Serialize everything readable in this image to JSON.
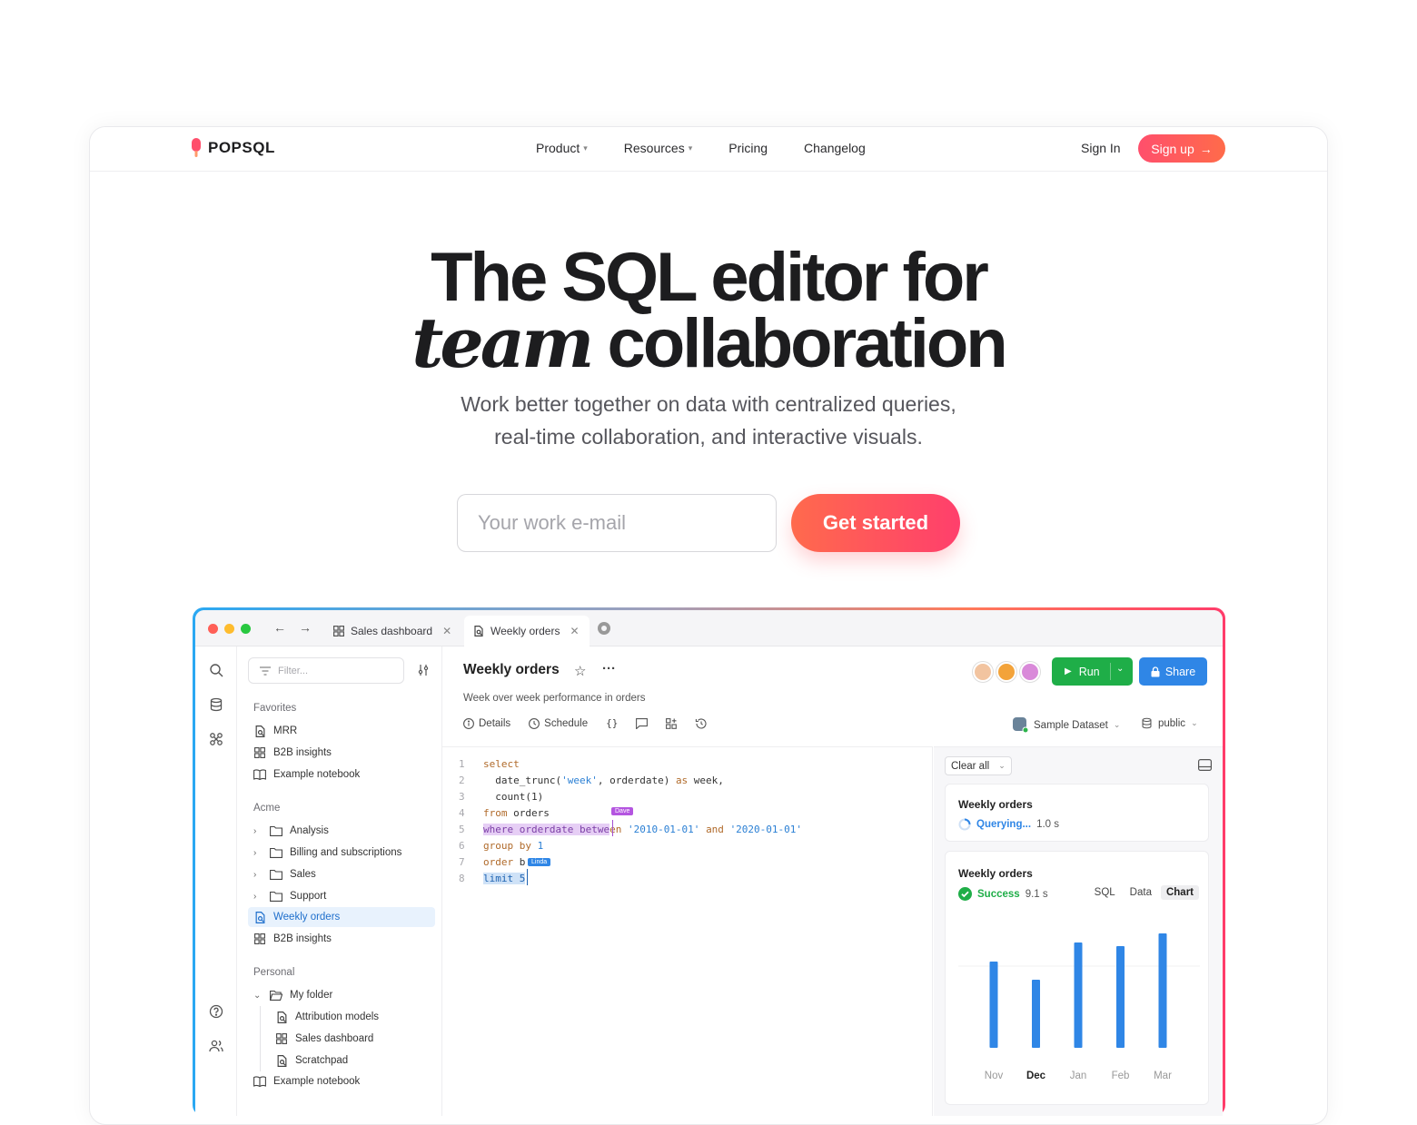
{
  "nav": {
    "logo": "POPSQL",
    "links": [
      {
        "label": "Product",
        "dropdown": true
      },
      {
        "label": "Resources",
        "dropdown": true
      },
      {
        "label": "Pricing",
        "dropdown": false
      },
      {
        "label": "Changelog",
        "dropdown": false
      }
    ],
    "signin": "Sign In",
    "signup": "Sign up"
  },
  "hero": {
    "line1": "The SQL editor for",
    "line2_em": "team",
    "line2_rest": "collaboration",
    "sub1": "Work better together on data with centralized queries,",
    "sub2": "real-time collaboration, and interactive visuals.",
    "email_placeholder": "Your work e-mail",
    "cta": "Get started"
  },
  "app": {
    "tabs": [
      {
        "label": "Sales dashboard",
        "icon": "grid-icon"
      },
      {
        "label": "Weekly orders",
        "icon": "query-icon",
        "active": true
      }
    ],
    "filter_placeholder": "Filter...",
    "favorites_head": "Favorites",
    "favorites": [
      {
        "label": "MRR",
        "icon": "query-icon"
      },
      {
        "label": "B2B insights",
        "icon": "grid-icon"
      },
      {
        "label": "Example notebook",
        "icon": "book-icon"
      }
    ],
    "acme_head": "Acme",
    "acme": [
      {
        "label": "Analysis",
        "icon": "folder-icon"
      },
      {
        "label": "Billing and subscriptions",
        "icon": "folder-icon"
      },
      {
        "label": "Sales",
        "icon": "folder-icon"
      },
      {
        "label": "Support",
        "icon": "folder-icon"
      },
      {
        "label": "Weekly orders",
        "icon": "query-icon",
        "active": true
      },
      {
        "label": "B2B insights",
        "icon": "grid-icon"
      }
    ],
    "personal_head": "Personal",
    "personal": [
      {
        "label": "My folder",
        "icon": "folder-open-icon"
      },
      {
        "label": "Attribution models",
        "icon": "query-icon"
      },
      {
        "label": "Sales dashboard",
        "icon": "grid-icon"
      },
      {
        "label": "Scratchpad",
        "icon": "query-icon"
      },
      {
        "label": "Example notebook",
        "icon": "book-icon"
      }
    ],
    "query_title": "Weekly orders",
    "query_desc": "Week over week performance in orders",
    "toolbar": {
      "details": "Details",
      "schedule": "Schedule"
    },
    "run": "Run",
    "share": "Share",
    "dataset": "Sample Dataset",
    "schema": "public",
    "code_line_numbers": [
      "1",
      "2",
      "3",
      "4",
      "5",
      "6",
      "7",
      "8"
    ],
    "cursor_dave": "Dave",
    "cursor_linda": "Linda",
    "results": {
      "clear_all": "Clear all",
      "card1_title": "Weekly orders",
      "card1_status": "Querying...",
      "card1_time": "1.0 s",
      "card2_title": "Weekly orders",
      "card2_status": "Success",
      "card2_time": "9.1 s",
      "view_tabs": [
        "SQL",
        "Data",
        "Chart"
      ],
      "selected_view": "Chart"
    },
    "colors": {
      "accent": "#ff4f6c",
      "run": "#1fae48",
      "share": "#2f86e6",
      "bar": "#2f86e6"
    }
  },
  "chart_data": {
    "type": "bar",
    "categories": [
      "Nov",
      "Dec",
      "Jan",
      "Feb",
      "Mar"
    ],
    "values": [
      95,
      75,
      116,
      112,
      126
    ],
    "highlighted_category": "Dec",
    "ylim": [
      0,
      130
    ],
    "grid": true
  }
}
